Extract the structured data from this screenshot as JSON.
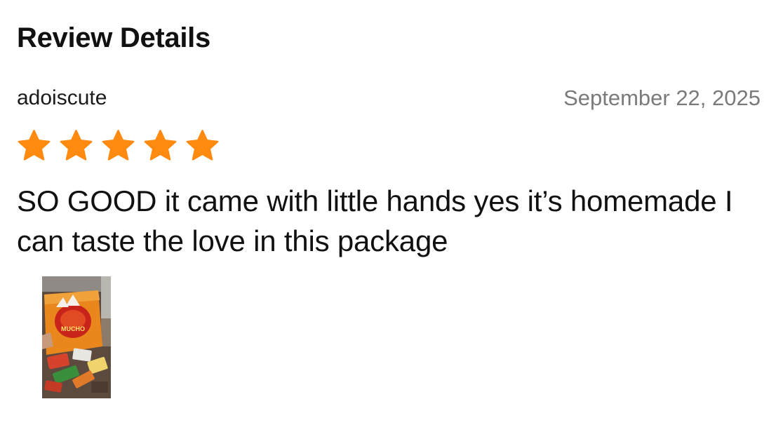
{
  "header": {
    "title": "Review Details"
  },
  "review": {
    "username": "adoiscute",
    "date": "September 22, 2025",
    "rating": 5,
    "rating_max": 5,
    "text": "SO GOOD it came with little hands yes it’s homemade I can taste the love in this package",
    "photo": {
      "package_text": "MUCHO"
    }
  },
  "colors": {
    "star": "#FF8A0F",
    "date": "#7A7A7A",
    "text": "#111111"
  },
  "icons": {
    "star": "star-icon"
  }
}
